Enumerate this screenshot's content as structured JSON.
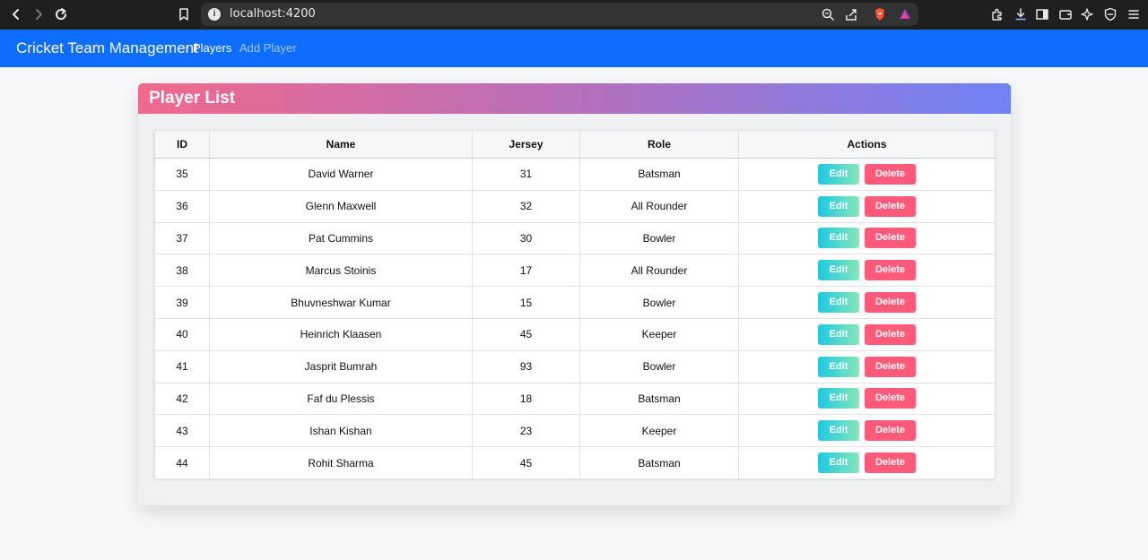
{
  "browser": {
    "url": "localhost:4200"
  },
  "navbar": {
    "brand": "Cricket Team Management",
    "links": [
      "Players",
      "Add Player"
    ],
    "color": "#0d6efd"
  },
  "card": {
    "title": "Player List"
  },
  "table": {
    "headers": [
      "ID",
      "Name",
      "Jersey",
      "Role",
      "Actions"
    ],
    "rows": [
      {
        "id": "35",
        "name": "David Warner",
        "jersey": "31",
        "role": "Batsman"
      },
      {
        "id": "36",
        "name": "Glenn Maxwell",
        "jersey": "32",
        "role": "All Rounder"
      },
      {
        "id": "37",
        "name": "Pat Cummins",
        "jersey": "30",
        "role": "Bowler"
      },
      {
        "id": "38",
        "name": "Marcus Stoinis",
        "jersey": "17",
        "role": "All Rounder"
      },
      {
        "id": "39",
        "name": "Bhuvneshwar Kumar",
        "jersey": "15",
        "role": "Bowler"
      },
      {
        "id": "40",
        "name": "Heinrich Klaasen",
        "jersey": "45",
        "role": "Keeper"
      },
      {
        "id": "41",
        "name": "Jasprit Bumrah",
        "jersey": "93",
        "role": "Bowler"
      },
      {
        "id": "42",
        "name": "Faf du Plessis",
        "jersey": "18",
        "role": "Batsman"
      },
      {
        "id": "43",
        "name": "Ishan Kishan",
        "jersey": "23",
        "role": "Keeper"
      },
      {
        "id": "44",
        "name": "Rohit Sharma",
        "jersey": "45",
        "role": "Batsman"
      }
    ],
    "edit_label": "Edit",
    "delete_label": "Delete"
  }
}
